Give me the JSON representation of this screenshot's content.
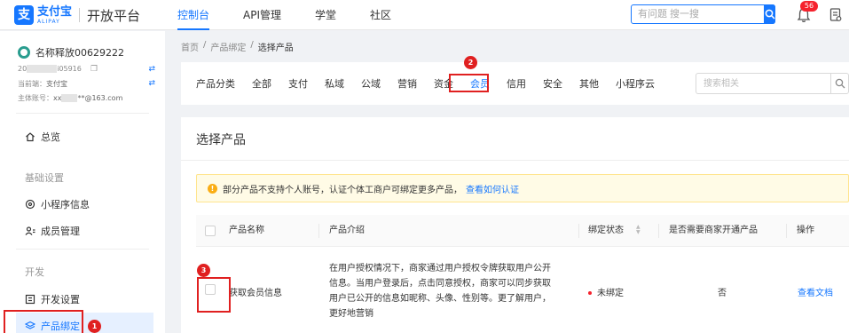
{
  "header": {
    "logo_cn": "支付宝",
    "logo_en": "ALIPAY",
    "platform": "开放平台",
    "nav": [
      "控制台",
      "API管理",
      "学堂",
      "社区"
    ],
    "search_placeholder": "有问题 搜一搜",
    "notification_count": "56",
    "accent_color": "#1677ff"
  },
  "sidebar": {
    "account_name": "名称释放00629222",
    "account_id_prefix": "20",
    "account_id_suffix": "i05916",
    "current_label": "当前端：",
    "current_value": "支付宝",
    "main_account_label": "主体账号：",
    "main_account_value_prefix": "xx",
    "main_account_value_suffix": "**@163.com",
    "overview": "总览",
    "group_basic": "基础设置",
    "miniapp_info": "小程序信息",
    "members": "成员管理",
    "group_dev": "开发",
    "dev_settings": "开发设置",
    "product_binding": "产品绑定"
  },
  "breadcrumb": [
    "首页",
    "/",
    "产品绑定",
    "/",
    "选择产品"
  ],
  "categories": {
    "items": [
      "产品分类",
      "全部",
      "支付",
      "私域",
      "公域",
      "营销",
      "资金",
      "会员",
      "信用",
      "安全",
      "其他",
      "小程序云"
    ],
    "active": "会员",
    "search_placeholder": "搜索相关"
  },
  "main": {
    "title": "选择产品",
    "notice": "部分产品不支持个人账号，认证个体工商户可绑定更多产品，",
    "notice_link": "查看如何认证",
    "columns": {
      "name": "产品名称",
      "intro": "产品介绍",
      "status": "绑定状态",
      "need_open": "是否需要商家开通产品",
      "action": "操作"
    },
    "row": {
      "name": "获取会员信息",
      "intro_lines": [
        "在用户授权情况下，商家通过用户授权令牌获取用户公开",
        "信息。当用户登录后，点击同意授权，商家可以同步获取",
        "用户已公开的信息如昵称、头像、性别等。更了解用户，",
        "更好地营销"
      ],
      "status": "未绑定",
      "need_open": "否",
      "action": "查看文档"
    }
  },
  "annotations": [
    "1",
    "2",
    "3"
  ],
  "annotation_color": "#e02020"
}
